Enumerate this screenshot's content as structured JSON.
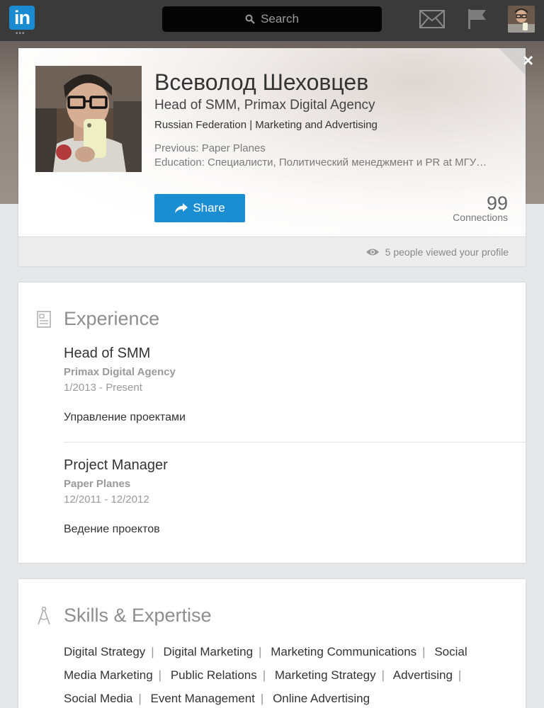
{
  "topbar": {
    "logo_text": "in",
    "logo_dots": "•••",
    "search_placeholder": "Search",
    "icons": [
      "mail-icon",
      "flag-icon"
    ]
  },
  "profile": {
    "name": "Всеволод Шеховцев",
    "headline": "Head of SMM, Primax Digital Agency",
    "location": "Russian Federation | Marketing and Advertising",
    "previous": "Previous: Paper Planes",
    "education": "Education: Специалисти, Политический менеджмент и PR at МГУ…",
    "share_label": "Share",
    "connections_count": "99",
    "connections_label": "Connections",
    "viewed_text": "5 people viewed your profile"
  },
  "close_label": "×",
  "experience": {
    "title": "Experience",
    "jobs": [
      {
        "title": "Head of SMM",
        "company": "Primax Digital Agency",
        "dates": "1/2013 - Present",
        "description": "Управление проектами"
      },
      {
        "title": "Project Manager",
        "company": "Paper Planes",
        "dates": "12/2011 - 12/2012",
        "description": "Ведение проектов"
      }
    ]
  },
  "skills": {
    "title": "Skills & Expertise",
    "items": [
      "Digital Strategy",
      "Digital Marketing",
      "Marketing Communications",
      "Social Media Marketing",
      "Public Relations",
      "Marketing Strategy",
      "Advertising",
      "Social Media",
      "Event Management",
      "Online Advertising"
    ]
  },
  "colors": {
    "brand": "#1a8ad1",
    "button": "#1b8ed3",
    "topbar": "#3a3a3a"
  }
}
